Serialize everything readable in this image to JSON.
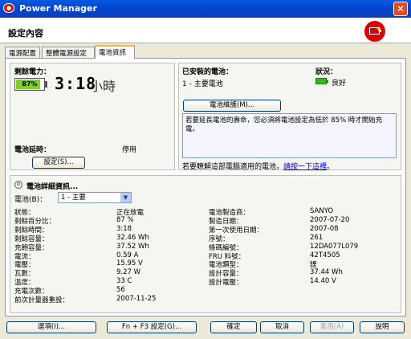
{
  "window": {
    "title": "Power Manager",
    "close_glyph": "✕"
  },
  "header": {
    "title": "設定內容",
    "plus_glyph": "+"
  },
  "tabs": [
    {
      "label": "電源配置"
    },
    {
      "label": "整體電源設定"
    },
    {
      "label": "電池資訊"
    }
  ],
  "battery_status": {
    "remaining_label": "剩餘電力：",
    "percent": "87%",
    "percent_value": 0.87,
    "time": "3:18",
    "time_unit": "小時",
    "delay_label": "電池延時：",
    "delay_value": "停用",
    "settings_button": "設定(S)..."
  },
  "installed": {
    "label": "已安裝的電池：",
    "value": "1 - 主要電池",
    "status_label": "狀況：",
    "status_value": "良好",
    "maintenance_button": "電池維護(M)...",
    "note": "若要延長電池的壽命，您必須將電池設定為低於 85% 時才開始充電。",
    "learn_text": "若要瞭解這部電腦適用的電池，",
    "learn_link": "請按一下這裡",
    "learn_end": "。"
  },
  "details": {
    "header": "電池詳細資訊...",
    "toggle_glyph": "⊙",
    "battery_label": "電池(B)：",
    "battery_select": "1 - 主要",
    "select_arrow": "▼",
    "left": [
      {
        "k": "狀態：",
        "v": "正在放電"
      },
      {
        "k": "剩餘百分比：",
        "v": "87 %"
      },
      {
        "k": "剩餘時間：",
        "v": "3:18"
      },
      {
        "k": "剩餘容量：",
        "v": "32.46 Wh"
      },
      {
        "k": "充飽容量：",
        "v": "37.52 Wh"
      },
      {
        "k": "電流：",
        "v": "0.59 A"
      },
      {
        "k": "電壓：",
        "v": "15.95 V"
      },
      {
        "k": "瓦數：",
        "v": "9.27 W"
      },
      {
        "k": "溫度：",
        "v": "33 C"
      },
      {
        "k": "充電次數：",
        "v": "56"
      },
      {
        "k": "前次計量器重設：",
        "v": "2007-11-25"
      }
    ],
    "right": [
      {
        "k": "電池製造商：",
        "v": "SANYO"
      },
      {
        "k": "製造日期：",
        "v": "2007-07-20"
      },
      {
        "k": "第一次使用日期：",
        "v": "2007-08"
      },
      {
        "k": "序號：",
        "v": "261"
      },
      {
        "k": "條碼編號：",
        "v": "12DA077L079"
      },
      {
        "k": "FRU 料號：",
        "v": "42T4505"
      },
      {
        "k": "電池類型：",
        "v": "鋰"
      },
      {
        "k": "設計容量：",
        "v": "37.44 Wh"
      },
      {
        "k": "設計電壓：",
        "v": "14.40 V"
      }
    ]
  },
  "footer": {
    "options": "選項(I)...",
    "fn_f3": "Fn + F3 設定(G)...",
    "ok": "確定",
    "cancel": "取消",
    "apply": "套用(A)",
    "help": "說明"
  }
}
